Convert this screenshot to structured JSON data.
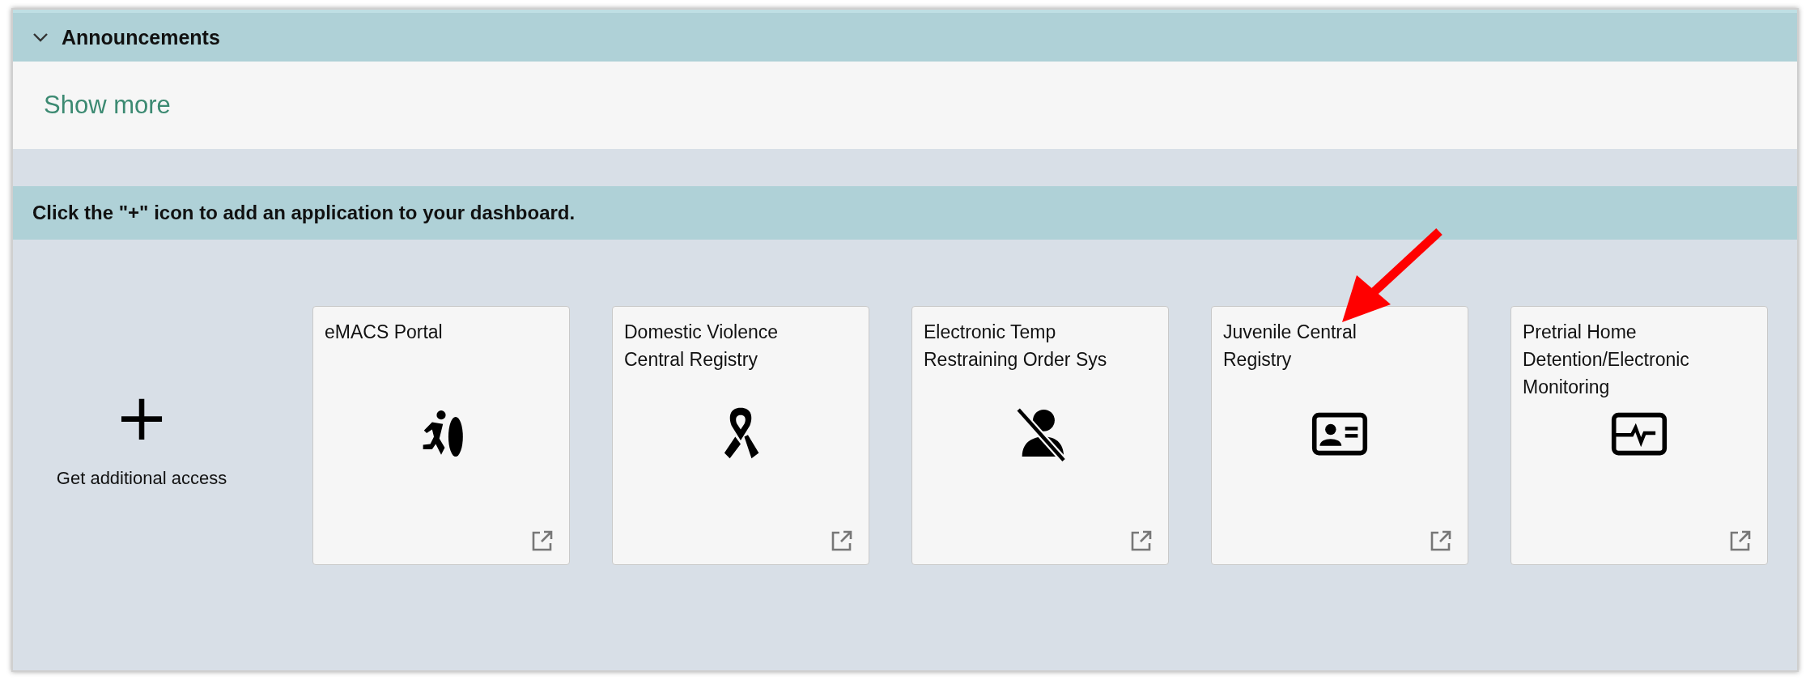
{
  "announcements": {
    "title": "Announcements",
    "expanded": true,
    "link": "Show more"
  },
  "apps_section": {
    "instruction": "Click the \"+\" icon to add an application to your dashboard.",
    "add_tile": {
      "icon": "+",
      "label": "Get additional access"
    },
    "tiles": [
      {
        "title": "eMACS Portal"
      },
      {
        "title": "Domestic Violence Central Registry"
      },
      {
        "title": "Electronic Temp Restraining Order Sys"
      },
      {
        "title": "Juvenile Central Registry"
      },
      {
        "title": "Pretrial Home Detention/Electronic Monitoring"
      }
    ]
  },
  "annotation": {
    "kind": "arrow"
  }
}
